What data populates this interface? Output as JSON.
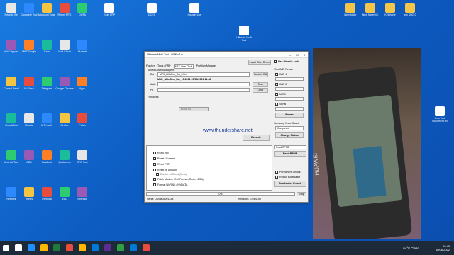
{
  "window": {
    "title": "Ultimate Multi Tool - MTK v5.0",
    "install_filter_driver": "Install Filter Driver",
    "tabs": [
      "Flasher",
      "Tools / FRP",
      "MTK One Click",
      "Partition Manager"
    ],
    "use_disable_auth": "Use Disable Auth",
    "select_download_agent": "Select Download Agent",
    "da_label": "DA",
    "da_value": "MTK_AllInOne_DA_5.bin",
    "custom_da": "Custom DA",
    "da_info": "M1K_AllInOne_DA_v3.3001 05/05/2021 11:48",
    "auth_label": "Auth",
    "pl_label": "PL",
    "clear": "Clear",
    "functions_label": "Functions",
    "functions": [
      {
        "label": "Read Info",
        "checked": true
      },
      {
        "label": "Reset / Format",
        "checked": true
      },
      {
        "label": "Reset FRP",
        "checked": false
      },
      {
        "label": "Reset Mi Account",
        "checked": false
      },
      {
        "label": "Disable MiCloud (Beta)",
        "checked": false
      },
      {
        "label": "Patch Modem / NV Format (Redmi 4/5A)",
        "checked": false
      },
      {
        "label": "Format NVRAM / NVDATA",
        "checked": false
      }
    ],
    "format_option": "Erase FS",
    "execute": "Execute",
    "watermark": "www.thundershare.net",
    "vivo_imei_repair": "Vivo IMEI Repair",
    "imei1": "IMEI 1",
    "imei2": "IMEI 2",
    "meid": "MEID",
    "serial": "Serial",
    "repair": "Repair",
    "samsung_knox_guard": "Samsung Knox Guard",
    "knox_value": "Completed",
    "change_status": "Change Status",
    "read_rpmb_option": "Read RPMB",
    "read_rpmb": "Read RPMB",
    "permanent_unlock": "Permanent Unlock",
    "relock_bootloader": "Relock Bootloader",
    "bootloader_unlock": "Bootloader Unlock",
    "progress_text": "0%",
    "stop": "Stop",
    "serial_status": "Serial: UMTB05001338",
    "os_status": "Windows 10 (64-bit)"
  },
  "desktop_icons": [
    "Recycle Bin",
    "Complete Tool",
    "Microsoft Edge",
    "Redmi MTK",
    "DOTA",
    "Win7 Bypass",
    "UMT Dongle",
    "Exor",
    "Mod Cloud",
    "Huawei",
    "Control Panel",
    "Mi Flash",
    "Telegram",
    "Google Chrome",
    "Apps",
    "UnlockTool",
    "Miracle",
    "MTK Auth",
    "Firefox",
    "Patch",
    "Android Tool",
    "ADB",
    "Fastboot",
    "Qualcomm",
    "SPD Tool",
    "Network",
    "Infinity",
    "Pandora",
    "VLC",
    "Notepad"
  ],
  "right_icons": [
    "New folder",
    "New folder (2)",
    "K2iphone",
    "win_20210"
  ],
  "top_files": [
    "DOTA",
    "Ultimate Multi Tool",
    "Huawei Lite",
    "Tools FRP"
  ],
  "right_file": "New Text Document.txt",
  "huawei_label": "HUAWEI",
  "taskbar": {
    "weather": "64°F Clear",
    "time": "02:43",
    "date": "16/06/2022",
    "colors": [
      "#ffffff",
      "#1e90ff",
      "#ffb900",
      "#1f7a3a",
      "#e74c3c",
      "#ffb900",
      "#0078d7",
      "#5c2d91",
      "#2ea043",
      "#0078d7",
      "#e74c3c"
    ]
  }
}
